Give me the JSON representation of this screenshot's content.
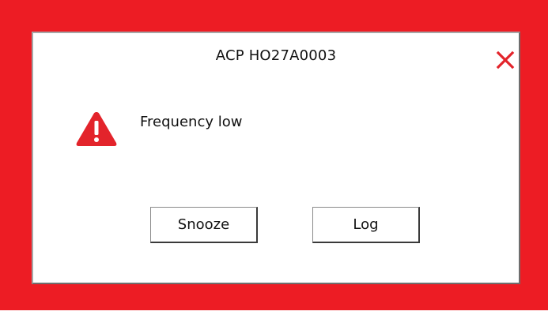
{
  "dialog": {
    "title": "ACP HO27A0003",
    "message": "Frequency low",
    "severity_icon": "warning-triangle-icon",
    "close_icon": "close-icon"
  },
  "buttons": {
    "snooze_label": "Snooze",
    "log_label": "Log"
  },
  "colors": {
    "alarm_frame": "#ed1c24",
    "warning_icon": "#e3242b",
    "close_icon": "#e3242b",
    "dialog_background": "#ffffff"
  }
}
